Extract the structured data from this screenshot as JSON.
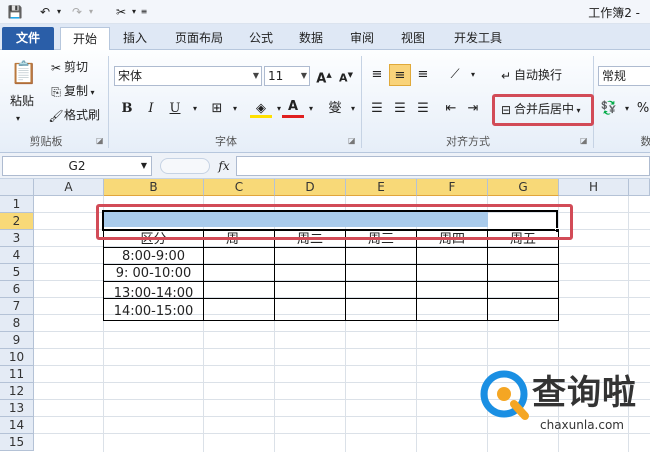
{
  "titlebar": {
    "app_title": "工作簿2 -"
  },
  "tabs": [
    {
      "label": "文件"
    },
    {
      "label": "开始"
    },
    {
      "label": "插入"
    },
    {
      "label": "页面布局"
    },
    {
      "label": "公式"
    },
    {
      "label": "数据"
    },
    {
      "label": "审阅"
    },
    {
      "label": "视图"
    },
    {
      "label": "开发工具"
    }
  ],
  "ribbon": {
    "clipboard": {
      "paste": "粘贴",
      "cut": "剪切",
      "copy": "复制",
      "format_painter": "格式刷",
      "group": "剪贴板"
    },
    "font": {
      "name": "宋体",
      "size": "11",
      "bold": "B",
      "italic": "I",
      "underline": "U",
      "group": "字体"
    },
    "alignment": {
      "wrap_text": "自动换行",
      "merge_center": "合并后居中",
      "group": "对齐方式"
    },
    "number": {
      "format": "常规",
      "percent": "%",
      "group_partial": "数"
    }
  },
  "formula_bar": {
    "name_box": "G2",
    "fx": "fx",
    "content": ""
  },
  "columns": [
    "A",
    "B",
    "C",
    "D",
    "E",
    "F",
    "G",
    "H"
  ],
  "rows": [
    "1",
    "2",
    "3",
    "4",
    "5",
    "6",
    "7",
    "8",
    "9",
    "10",
    "11",
    "12",
    "13",
    "14",
    "15"
  ],
  "table": {
    "header": [
      "区分",
      "周一",
      "周二",
      "周三",
      "周四",
      "周五"
    ],
    "times": [
      "8:00-9:00",
      "9: 00-10:00",
      "13:00-14:00",
      "14:00-15:00"
    ]
  },
  "watermark": {
    "text": "查询啦",
    "url": "chaxunla.com"
  },
  "colors": {
    "accent_red": "#d24b57",
    "selection_blue": "#a9cbeb",
    "file_tab": "#2a5ea8",
    "header_selected": "#f8d978"
  }
}
